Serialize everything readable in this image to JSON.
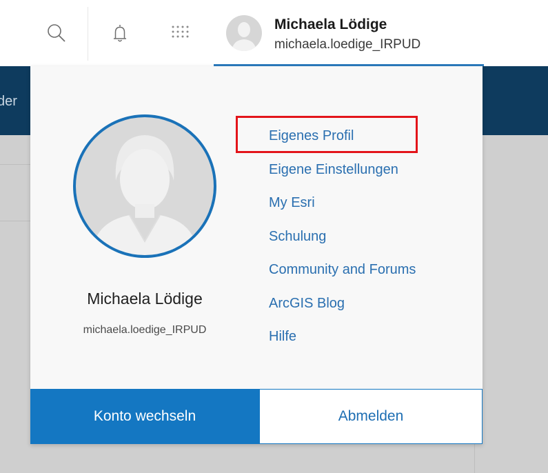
{
  "header": {
    "icons": [
      "search-icon",
      "bell-icon",
      "apps-grid-icon"
    ],
    "user_name": "Michaela Lödige",
    "username": "michaela.loedige_IRPUD"
  },
  "background": {
    "nav_text_fragment": "der"
  },
  "dropdown": {
    "full_name": "Michaela Lödige",
    "username": "michaela.loedige_IRPUD",
    "menu_items": [
      "Eigenes Profil",
      "Eigene Einstellungen",
      "My Esri",
      "Schulung",
      "Community and Forums",
      "ArcGIS Blog",
      "Hilfe"
    ],
    "highlighted_item": "Eigenes Profil",
    "switch_account_label": "Konto wechseln",
    "sign_out_label": "Abmelden"
  },
  "colors": {
    "accent": "#1477c2",
    "link": "#2a6fb0",
    "nav_band": "#0e3b5e",
    "highlight_box": "#e3141a"
  }
}
